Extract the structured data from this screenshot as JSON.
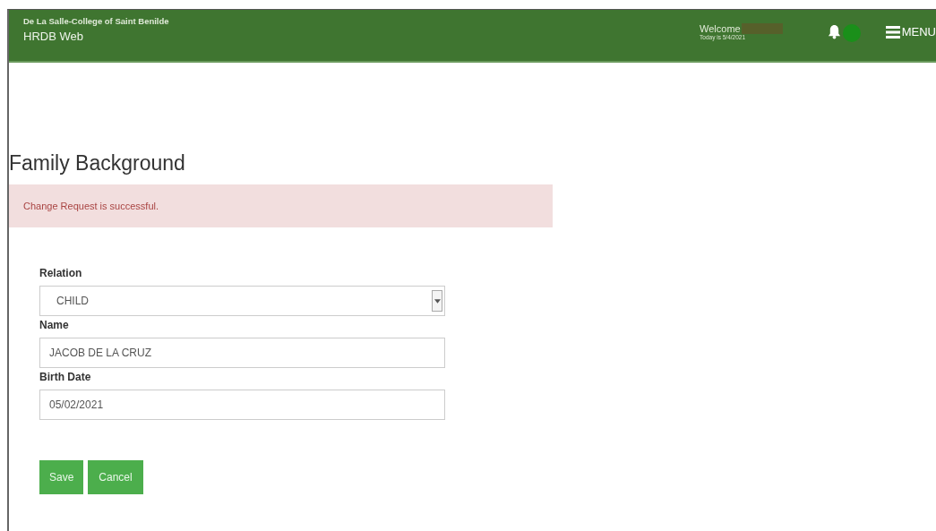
{
  "header": {
    "org": "De La Salle-College of Saint Benilde",
    "app": "HRDB Web",
    "welcome": "Welcome",
    "today": "Today is 5/4/2021",
    "menu_label": "MENU"
  },
  "page_title": "Family Background",
  "alert": {
    "kind": "danger",
    "text": "Change Request is successful."
  },
  "fields": [
    {
      "kind": "select",
      "label": "Relation",
      "value": "CHILD"
    },
    {
      "kind": "text",
      "label": "Name",
      "value": "JACOB DE LA CRUZ"
    },
    {
      "kind": "text",
      "label": "Birth Date",
      "value": "05/02/2021"
    }
  ],
  "buttons": [
    "Save",
    "Cancel"
  ]
}
